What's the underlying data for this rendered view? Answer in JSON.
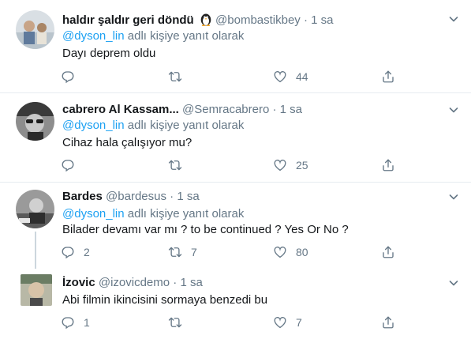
{
  "reply_prefix": "@dyson_lin",
  "reply_suffix": "adlı kişiye yanıt olarak",
  "separator": "·",
  "tweets": [
    {
      "name": "haldır şaldır geri döndü",
      "badge_icon": "penguin-emoji-icon",
      "handle": "@bombastikbey",
      "time": "1 sa",
      "has_reply_to": true,
      "text": "Dayı deprem oldu",
      "replies": "",
      "retweets": "",
      "likes": "44"
    },
    {
      "name": "cabrero Al Kassam...",
      "handle": "@Semracabrero",
      "time": "1 sa",
      "has_reply_to": true,
      "text": "Cihaz hala çalışıyor mu?",
      "replies": "",
      "retweets": "",
      "likes": "25"
    },
    {
      "name": "Bardes",
      "handle": "@bardesus",
      "time": "1 sa",
      "has_reply_to": true,
      "text": "Bilader devamı var mı ? to be continued ? Yes Or No ?",
      "replies": "2",
      "retweets": "7",
      "likes": "80"
    },
    {
      "name": "İzovic",
      "handle": "@izovicdemo",
      "time": "1 sa",
      "has_reply_to": false,
      "text": "Abi filmin ikincisini sormaya benzedi bu",
      "replies": "1",
      "retweets": "",
      "likes": "7"
    }
  ],
  "colors": {
    "accent": "#1da1f2",
    "secondary_text": "#657786",
    "divider": "#e6ecf0"
  }
}
